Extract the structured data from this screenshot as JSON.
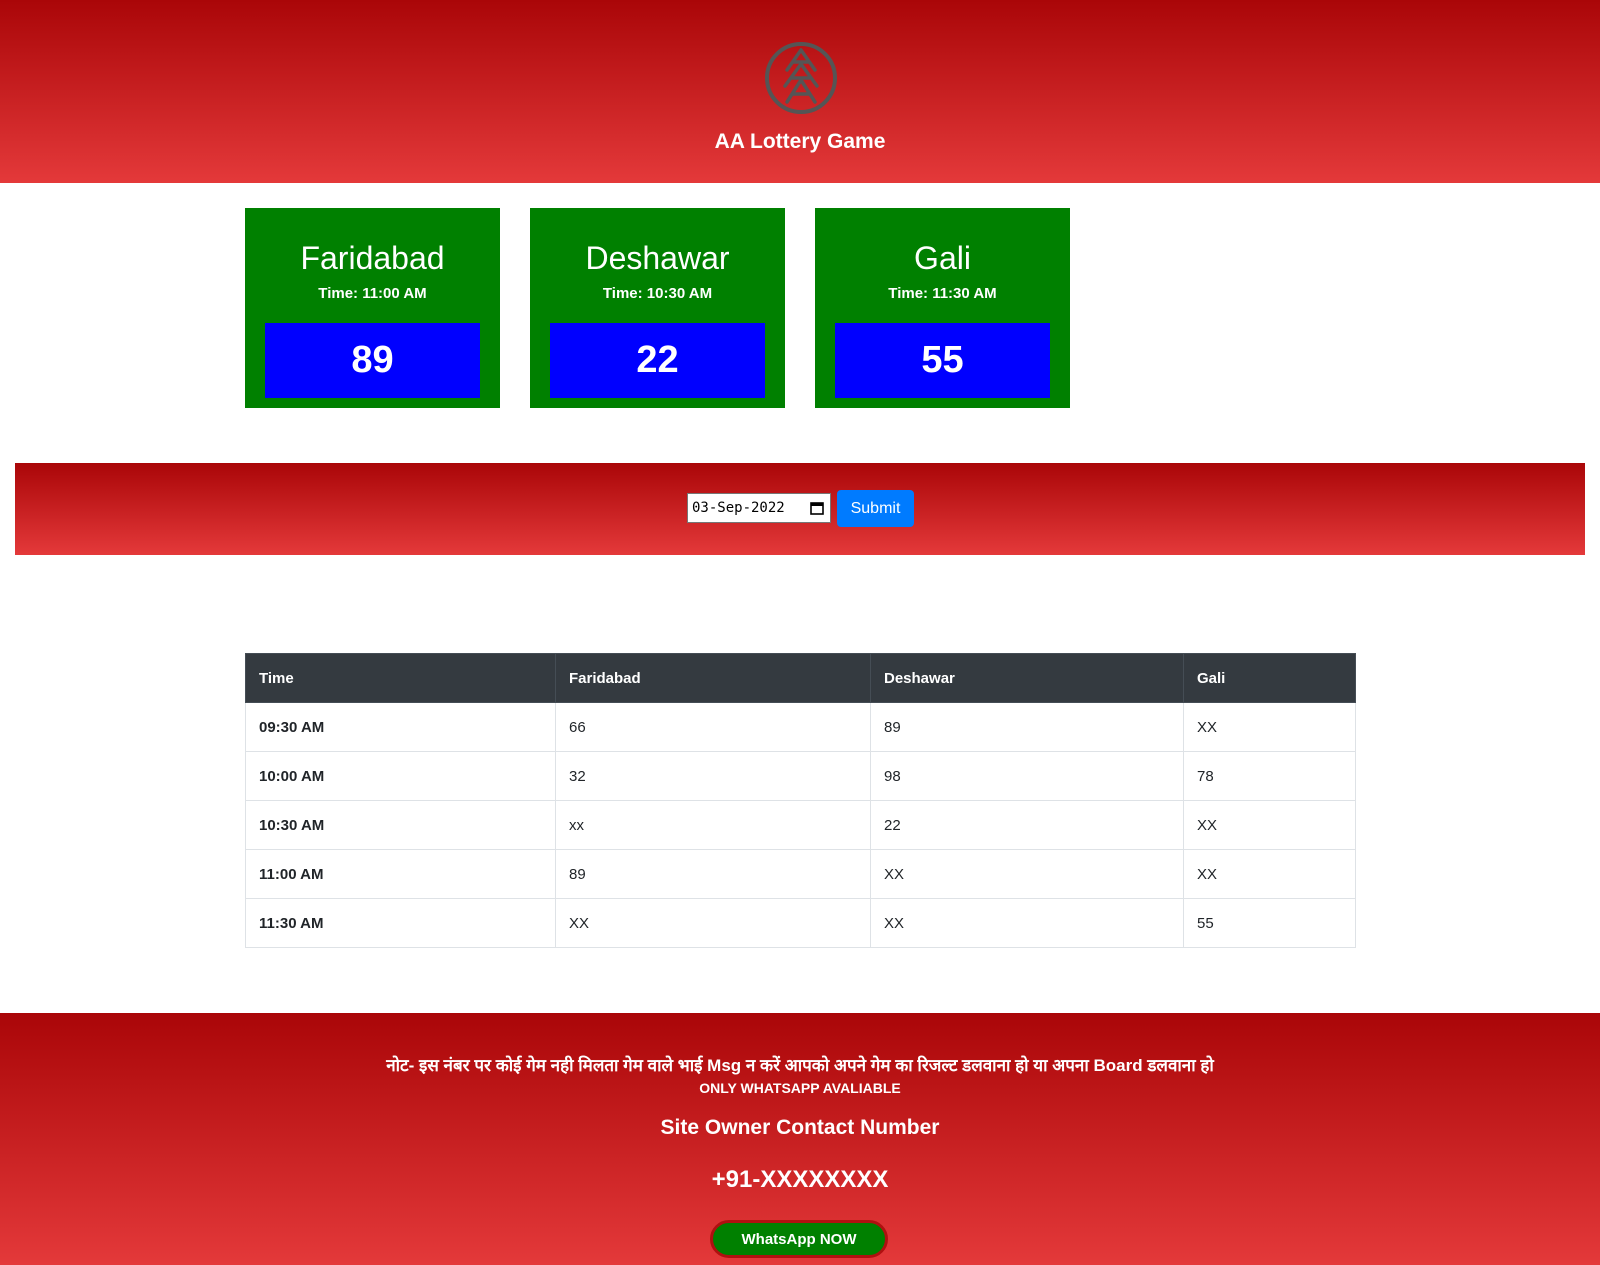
{
  "header": {
    "title": "AA Lottery Game",
    "logo_icon": "aa-logo-icon"
  },
  "games": [
    {
      "name": "Faridabad",
      "time": "Time: 11:00 AM",
      "result": "89"
    },
    {
      "name": "Deshawar",
      "time": "Time: 10:30 AM",
      "result": "22"
    },
    {
      "name": "Gali",
      "time": "Time: 11:30 AM",
      "result": "55"
    }
  ],
  "date_form": {
    "value": "03-Sep-2022",
    "submit_label": "Submit"
  },
  "table": {
    "headers": [
      "Time",
      "Faridabad",
      "Deshawar",
      "Gali"
    ],
    "rows": [
      [
        "09:30 AM",
        "66",
        "89",
        "XX"
      ],
      [
        "10:00 AM",
        "32",
        "98",
        "78"
      ],
      [
        "10:30 AM",
        "xx",
        "22",
        "XX"
      ],
      [
        "11:00 AM",
        "89",
        "XX",
        "XX"
      ],
      [
        "11:30 AM",
        "XX",
        "XX",
        "55"
      ]
    ]
  },
  "footer": {
    "note": "नोट- इस नंबर पर कोई गेम नही मिलता गेम वाले भाई Msg न करें आपको अपने गेम का रिजल्ट डलवाना हो या अपना Board डलवाना हो",
    "only_whatsapp": "ONLY WHATSAPP AVALIABLE",
    "contact_title": "Site Owner Contact Number",
    "phone": "+91-XXXXXXXX",
    "whatsapp_label": "WhatsApp NOW"
  },
  "colors": {
    "header_gradient_top": "#aa0608",
    "header_gradient_bottom": "#e4393a",
    "card_bg": "#008000",
    "result_bg": "#0000ff",
    "submit_bg": "#007bff",
    "table_header_bg": "#343a40"
  }
}
